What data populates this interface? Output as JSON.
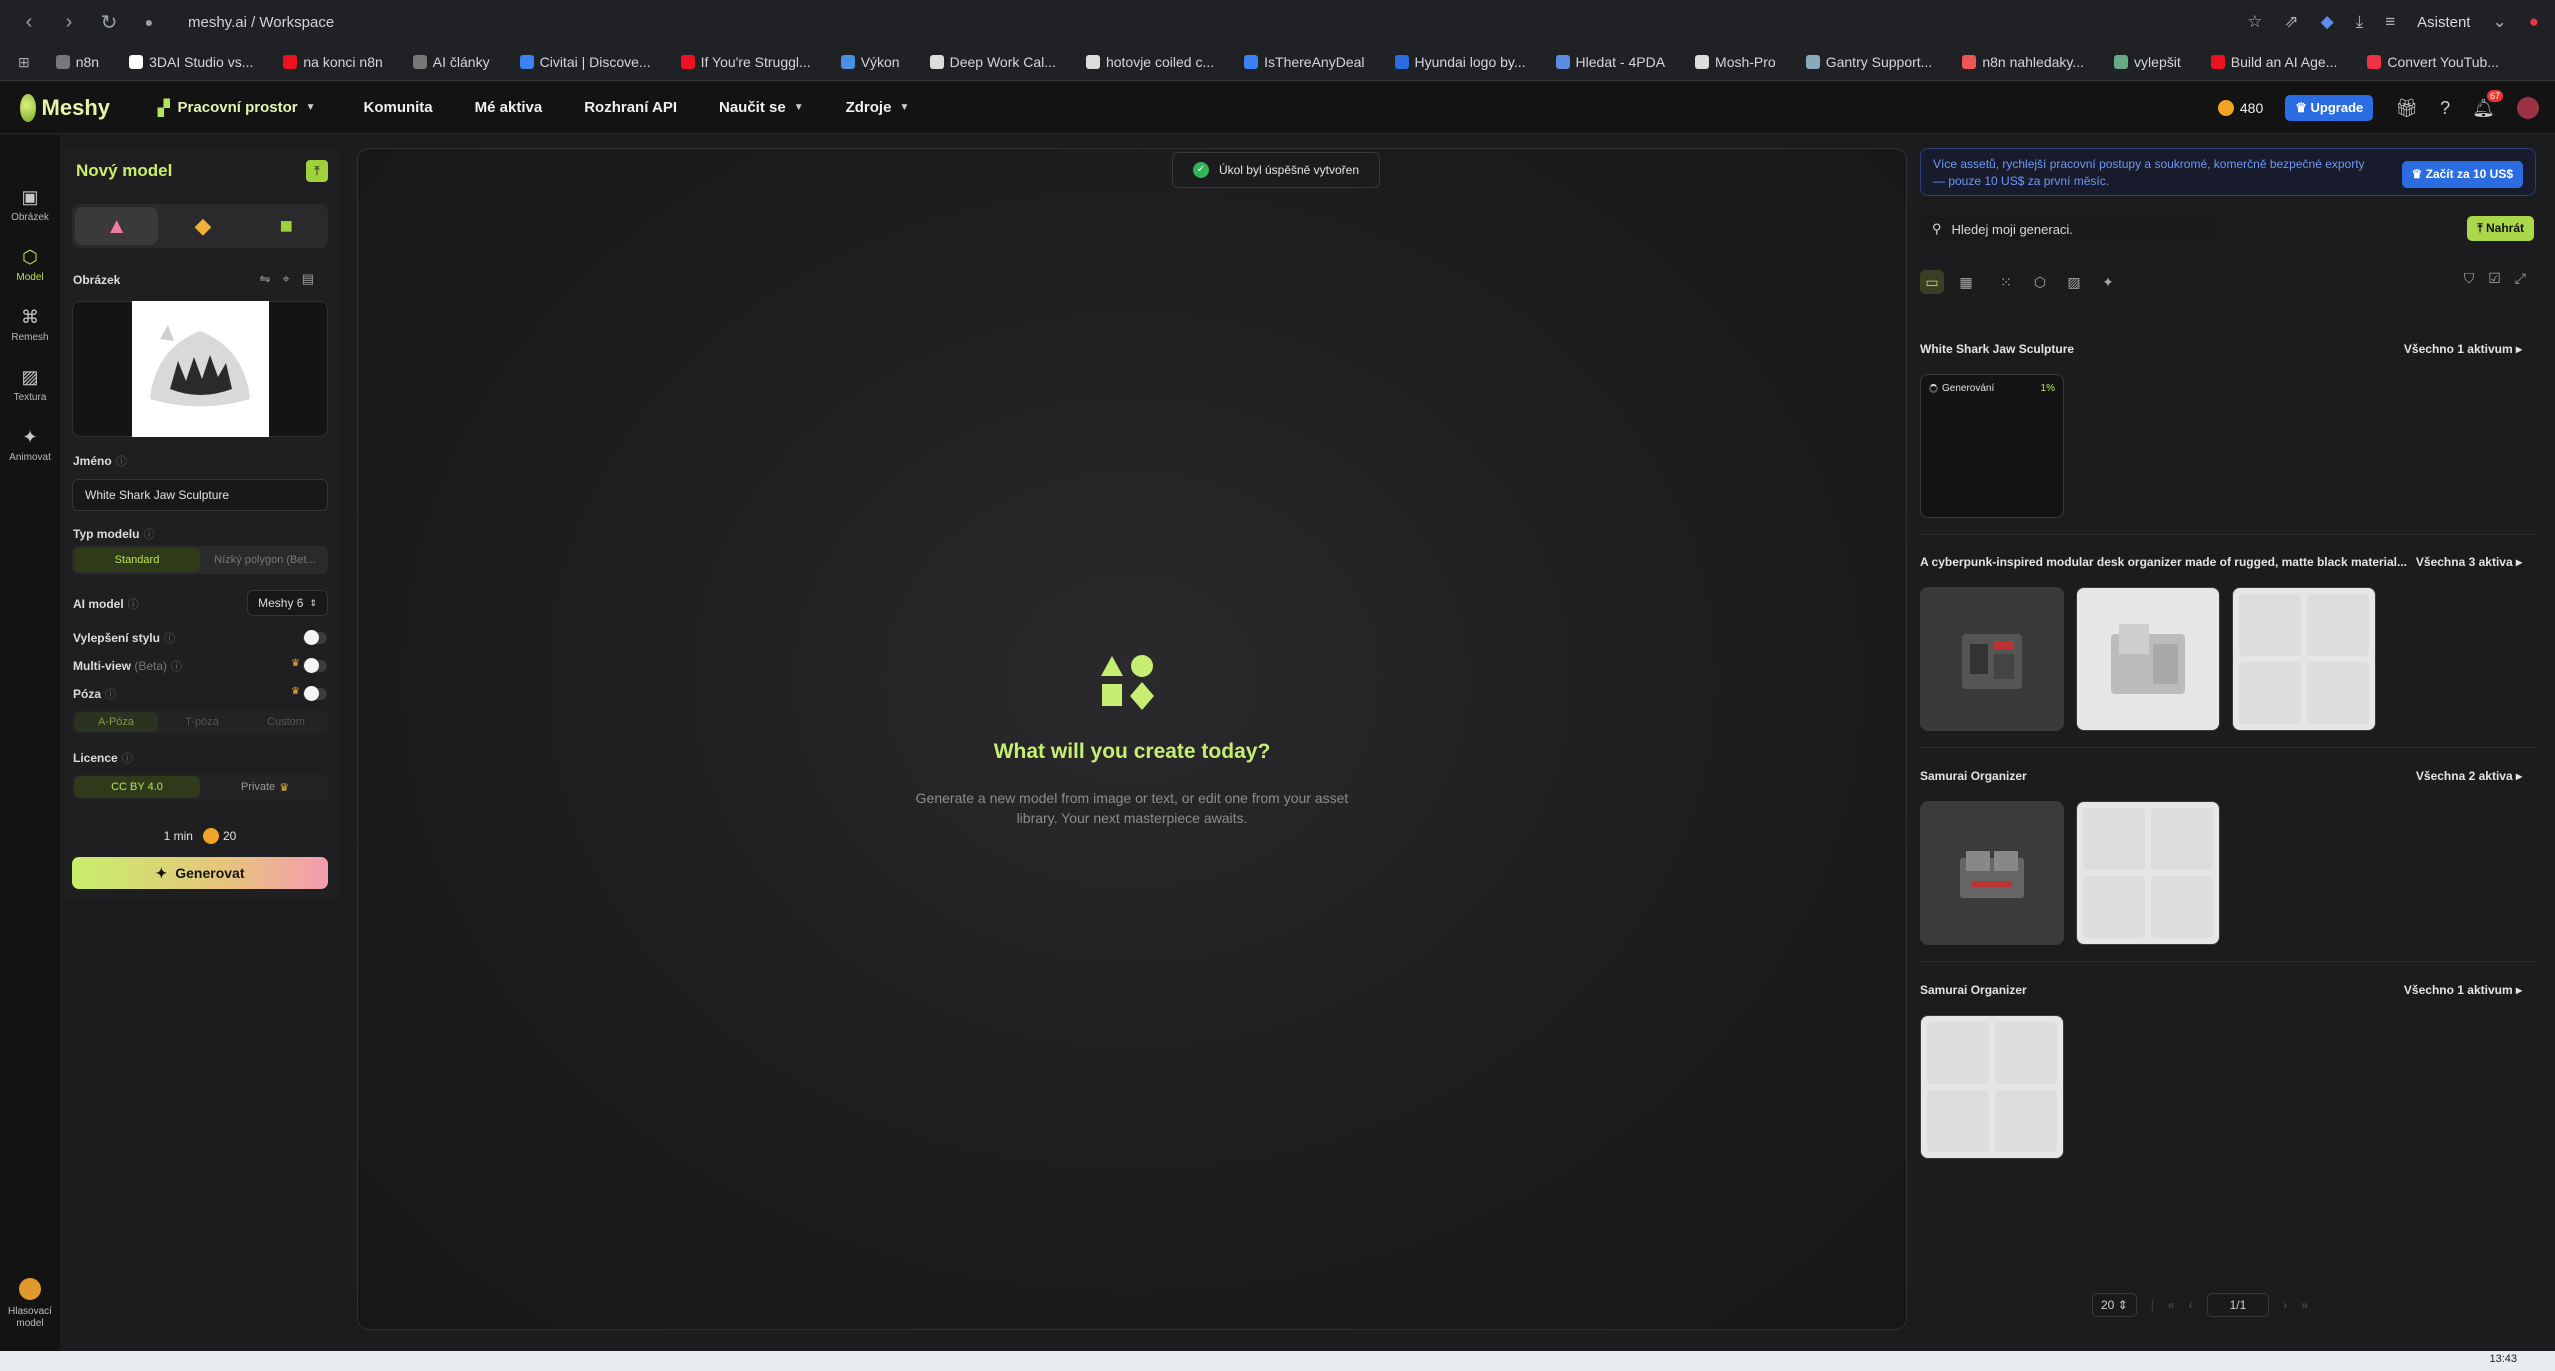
{
  "browser": {
    "url": "meshy.ai / Workspace",
    "assistant_label": "Asistent",
    "bookmarks": [
      {
        "label": "n8n",
        "color": "#777"
      },
      {
        "label": "3DAI Studio vs...",
        "color": "#fff"
      },
      {
        "label": "na konci n8n",
        "color": "#e12"
      },
      {
        "label": "AI články",
        "color": "#777"
      },
      {
        "label": "Civitai | Discove...",
        "color": "#3b82f6"
      },
      {
        "label": "If You're Struggl...",
        "color": "#e12"
      },
      {
        "label": "Výkon",
        "color": "#4a90e2"
      },
      {
        "label": "Deep Work Cal...",
        "color": "#ddd"
      },
      {
        "label": "hotovje coiled c...",
        "color": "#ddd"
      },
      {
        "label": "IsThereAnyDeal",
        "color": "#3b82f6"
      },
      {
        "label": "Hyundai logo by...",
        "color": "#2a6de0"
      },
      {
        "label": "Hledat - 4PDA",
        "color": "#5a8de0"
      },
      {
        "label": "Mosh-Pro",
        "color": "#ddd"
      },
      {
        "label": "Gantry Support...",
        "color": "#8ab"
      },
      {
        "label": "n8n nahledaky...",
        "color": "#e55"
      },
      {
        "label": "vylepšit",
        "color": "#6a8"
      },
      {
        "label": "Build an AI Age...",
        "color": "#e12"
      },
      {
        "label": "Convert YouTub...",
        "color": "#e34"
      }
    ]
  },
  "header": {
    "logo_text": "Meshy",
    "nav": [
      {
        "label": "Pracovní prostor",
        "has_caret": true
      },
      {
        "label": "Komunita",
        "has_caret": false
      },
      {
        "label": "Mé aktiva",
        "has_caret": false
      },
      {
        "label": "Rozhraní API",
        "has_caret": false
      },
      {
        "label": "Naučit se",
        "has_caret": true
      },
      {
        "label": "Zdroje",
        "has_caret": true
      }
    ],
    "credits": "480",
    "upgrade_label": "Upgrade",
    "notification_count": "67"
  },
  "rail": {
    "items": [
      {
        "label": "Obrázek",
        "icon": "image-icon",
        "glyph": "▣"
      },
      {
        "label": "Model",
        "icon": "cube-icon",
        "glyph": "⬡"
      },
      {
        "label": "Remesh",
        "icon": "remesh-icon",
        "glyph": "⌘"
      },
      {
        "label": "Textura",
        "icon": "texture-icon",
        "glyph": "▨"
      },
      {
        "label": "Animovat",
        "icon": "run-icon",
        "glyph": "✦"
      }
    ],
    "voting_label": "Hlasovací model"
  },
  "panel": {
    "title": "Nový model",
    "image_label": "Obrázek",
    "name_label": "Jméno",
    "name_value": "White Shark Jaw Sculpture",
    "type_label": "Typ modelu",
    "type_options": [
      "Standard",
      "Nízký polygon (Bet..."
    ],
    "ai_label": "AI model",
    "ai_value": "Meshy 6",
    "style_label": "Vylepšení stylu",
    "multiview_label": "Multi-view",
    "multiview_badge": "(Beta)",
    "pose_label": "Póza",
    "pose_options": [
      "A-Póza",
      "T-póza",
      "Custom"
    ],
    "license_label": "Licence",
    "license_options": [
      "CC BY 4.0",
      "Private"
    ],
    "time": "1 min",
    "cost": "20",
    "generate_label": "Generovat"
  },
  "canvas": {
    "toast": "Úkol byl úspěšně vytvořen",
    "title": "What will you create today?",
    "subtitle": "Generate a new model from image or text, or edit one from your asset library. Your next masterpiece awaits."
  },
  "right": {
    "promo_text": "Více assetů, rychlejší pracovní postupy a soukromé, komerčně bezpečné exporty — pouze 10 US$ za první měsíc.",
    "promo_button": "Začít za 10 US$",
    "search_placeholder": "Hledej moji generaci.",
    "upload_label": "Nahrát",
    "groups": [
      {
        "title": "White Shark Jaw Sculpture",
        "all": "Všechno 1 aktivum",
        "status": "Generování",
        "progress": "1%"
      },
      {
        "title": "A cyberpunk-inspired modular desk organizer made of rugged, matte black material...",
        "all": "Všechna 3 aktiva"
      },
      {
        "title": "Samurai Organizer",
        "all": "Všechna 2 aktiva"
      },
      {
        "title": "Samurai Organizer",
        "all": "Všechno 1 aktivum"
      }
    ],
    "page_size": "20",
    "page": "1/1"
  },
  "taskbar": {
    "time": "13:43"
  }
}
